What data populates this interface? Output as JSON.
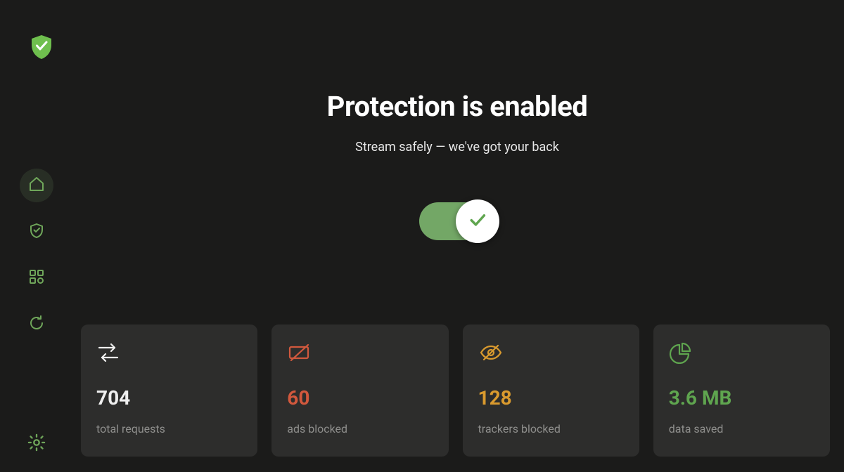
{
  "colors": {
    "accent_green": "#5fa54f",
    "red": "#d1583d",
    "orange": "#d99a2e",
    "card_bg": "#2d2d2c",
    "bg": "#1b1b1a"
  },
  "sidebar": {
    "items": [
      {
        "key": "home",
        "icon": "home-icon",
        "active": true
      },
      {
        "key": "shield",
        "icon": "shield-icon",
        "active": false
      },
      {
        "key": "apps",
        "icon": "apps-icon",
        "active": false
      },
      {
        "key": "refresh",
        "icon": "refresh-icon",
        "active": false
      }
    ],
    "settings_icon": "gear-icon"
  },
  "main": {
    "title": "Protection is enabled",
    "subtitle": "Stream safely — we've got your back",
    "toggle_on": true
  },
  "stats": [
    {
      "icon": "arrows-icon",
      "value": "704",
      "label": "total requests",
      "color": "white"
    },
    {
      "icon": "rect-slash-icon",
      "value": "60",
      "label": "ads blocked",
      "color": "red"
    },
    {
      "icon": "eye-slash-icon",
      "value": "128",
      "label": "trackers blocked",
      "color": "orange"
    },
    {
      "icon": "pie-icon",
      "value": "3.6 MB",
      "label": "data saved",
      "color": "green"
    }
  ]
}
